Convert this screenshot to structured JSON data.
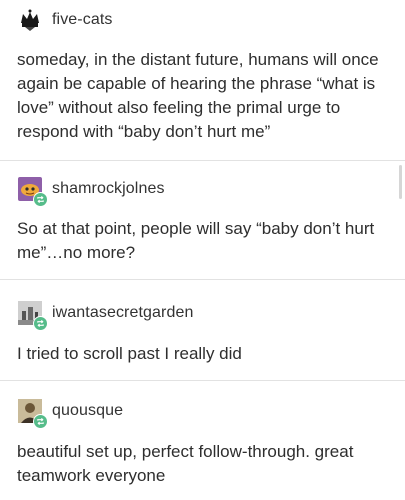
{
  "posts": [
    {
      "username": "five-cats",
      "text": "someday, in the distant future, humans will once again be capable of hearing the phrase “what is love” without also feeling the primal urge to  respond with “baby don’t hurt me”",
      "avatar_icon": "crown-cat-avatar-icon"
    },
    {
      "username": "shamrockjolnes",
      "text": "So at that point, people will say “baby don’t hurt me”…no more?",
      "avatar_icon": "purple-creature-avatar-icon",
      "reblog_icon": "reblog-icon"
    },
    {
      "username": "iwantasecretgarden",
      "text": "I tried to scroll past I really did",
      "avatar_icon": "garden-avatar-icon",
      "reblog_icon": "reblog-icon"
    },
    {
      "username": "quousque",
      "text": "beautiful set up, perfect follow-through. great teamwork everyone",
      "avatar_icon": "portrait-avatar-icon",
      "reblog_icon": "reblog-icon"
    }
  ],
  "colors": {
    "text": "#2e2e2e",
    "divider": "#e2e2e2",
    "reblog_badge": "#56bc8a"
  }
}
